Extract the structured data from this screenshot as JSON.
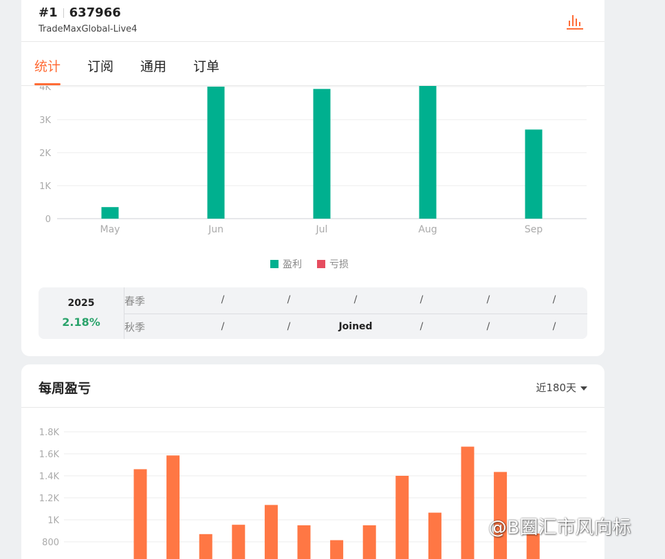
{
  "header": {
    "rank": "#1",
    "account": "637966",
    "server": "TradeMaxGlobal-Live4",
    "chart_icon": "bar-chart-icon"
  },
  "tabs": [
    {
      "label": "统计",
      "active": true
    },
    {
      "label": "订阅",
      "active": false
    },
    {
      "label": "通用",
      "active": false
    },
    {
      "label": "订单",
      "active": false
    }
  ],
  "colors": {
    "accent": "#ff6b35",
    "profit": "#00b08f",
    "loss": "#e64d5f",
    "positive": "#2aa36b",
    "weekly_bar": "#ff7744"
  },
  "legend": {
    "profit": "盈利",
    "loss": "亏损"
  },
  "season_table": {
    "year": "2025",
    "percent": "2.18%",
    "rows": [
      {
        "label": "春季",
        "cells": [
          "/",
          "/",
          "/",
          "/",
          "/",
          "/"
        ]
      },
      {
        "label": "秋季",
        "cells": [
          "/",
          "/",
          "Joined",
          "/",
          "/",
          "/"
        ]
      }
    ]
  },
  "weekly": {
    "title": "每周盈亏",
    "range_label": "近180天"
  },
  "watermark": "@B圈汇市风向标",
  "chart_data": [
    {
      "type": "bar",
      "categories": [
        "May",
        "Jun",
        "Jul",
        "Aug",
        "Sep"
      ],
      "series": [
        {
          "name": "盈利",
          "values": [
            350,
            4000,
            3930,
            4050,
            2700
          ]
        },
        {
          "name": "亏损",
          "values": [
            0,
            0,
            0,
            0,
            0
          ]
        }
      ],
      "yticks": [
        "0",
        "1K",
        "2K",
        "3K",
        "4K"
      ],
      "ylim": [
        0,
        4000
      ],
      "title": "",
      "xlabel": "",
      "ylabel": "",
      "legend": "bottom-center",
      "grid": true
    },
    {
      "type": "bar",
      "values": [
        1460,
        1585,
        870,
        955,
        1135,
        950,
        815,
        950,
        1400,
        1065,
        1665,
        1435,
        875
      ],
      "yticks": [
        "800",
        "1K",
        "1.2K",
        "1.4K",
        "1.6K",
        "1.8K"
      ],
      "ylim": [
        800,
        1800
      ],
      "title": "",
      "xlabel": "",
      "ylabel": "",
      "grid": true
    }
  ]
}
